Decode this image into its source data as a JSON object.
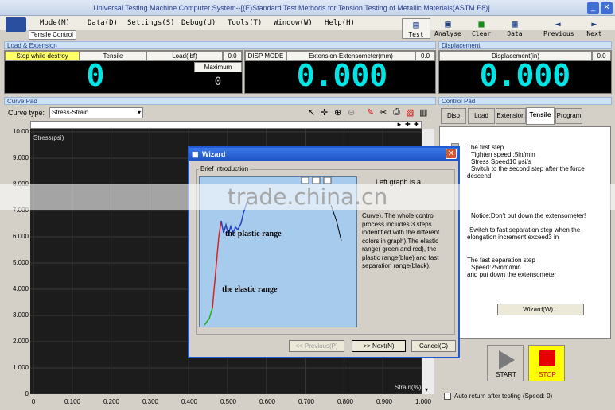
{
  "window": {
    "title": "Universal Testing Machine Computer System--[(E)Standard Test Methods for Tension Testing of Metallic Materials(ASTM E8)]"
  },
  "menu": [
    "Mode(M)",
    "Data(D)",
    "Settings(S)",
    "Debug(U)",
    "Tools(T)",
    "Window(W)",
    "Help(H)"
  ],
  "mode_label": "Tensile Control",
  "toolbar": [
    {
      "label": "Test",
      "icon": "test-icon",
      "glyph": "▤"
    },
    {
      "label": "Analyse",
      "icon": "analyse-icon",
      "glyph": "▣"
    },
    {
      "label": "Clear",
      "icon": "clear-icon",
      "glyph": "■"
    },
    {
      "label": "Data",
      "icon": "data-icon",
      "glyph": "▦"
    },
    {
      "label": "Previous",
      "icon": "arrow-left-icon",
      "glyph": "◄"
    },
    {
      "label": "Next",
      "icon": "arrow-right-icon",
      "glyph": "►"
    }
  ],
  "load_panel": {
    "title": "Load & Extension",
    "stop_label": "Stop while destroy",
    "tensile_label": "Tensile",
    "load_label": "Load(lbf)",
    "load_unit_val": "0.0",
    "load_value": "0",
    "maximum_label": "Maximum",
    "maximum_value": "0",
    "disp_mode": "DISP MODE",
    "ext_label": "Extension-Extensometer(mm)",
    "ext_unit_val": "0.0",
    "ext_value": "0.000"
  },
  "displacement_panel": {
    "title": "Displacement",
    "label": "Displacement(in)",
    "unit_val": "0.0",
    "value": "0.000"
  },
  "curve_pad": {
    "title": "Curve Pad",
    "curve_type_label": "Curve type:",
    "curve_type_value": "Stress-Strain",
    "y_axis_label": "Stress(psi)",
    "x_axis_label": "Strain(%)",
    "y_ticks": [
      "10.00",
      "9.000",
      "8.000",
      "7.000",
      "6.000",
      "5.000",
      "4.000",
      "3.000",
      "2.000",
      "1.000",
      "0"
    ],
    "x_ticks": [
      "0",
      "0.100",
      "0.200",
      "0.300",
      "0.400",
      "0.500",
      "0.600",
      "0.700",
      "0.800",
      "0.900",
      "1.000"
    ]
  },
  "control_pad": {
    "title": "Control Pad",
    "tabs": [
      "Disp",
      "Load",
      "Extension",
      "Tensile",
      "Program"
    ],
    "active_tab": "Tensile",
    "text": {
      "l1": "The first step",
      "l2": "Tighten speed :5in/min",
      "l3": "Stress Speed10 psi/s",
      "l4": "Switch to the second step after the force",
      "l5": "descend",
      "l6": "Notice:Don't put down the extensometer!",
      "l7": "Switch to fast separation step when the",
      "l8": "elongation increment exceed3 in",
      "l9": "The fast separation step",
      "l10": "Speed:25mm/min",
      "l11": "and put down the extensometer"
    },
    "wizard_button": "Wizard(W)...",
    "start_label": "START",
    "stop_label": "STOP",
    "auto_return": "Auto return after testing (Speed: 0)"
  },
  "wizard": {
    "title": "Wizard",
    "group_title": "Brief introduction",
    "plastic_label": "the plastic range",
    "elastic_label": "the elastic range",
    "description": "Curve). The whole control process includes 3 steps indentified with the different colors in graph).The elastic range( green and red), the plastic range(blue) and fast separation range(black).",
    "description_top": "Left graph is a",
    "prev_button": "<< Previous(P)",
    "next_button": ">> Next(N)",
    "cancel_button": "Cancel(C)"
  },
  "watermark": "trade.china.cn",
  "colors": {
    "digit": "#00e5e5",
    "title_blue": "#1f53c6",
    "stop": "#e60000"
  }
}
